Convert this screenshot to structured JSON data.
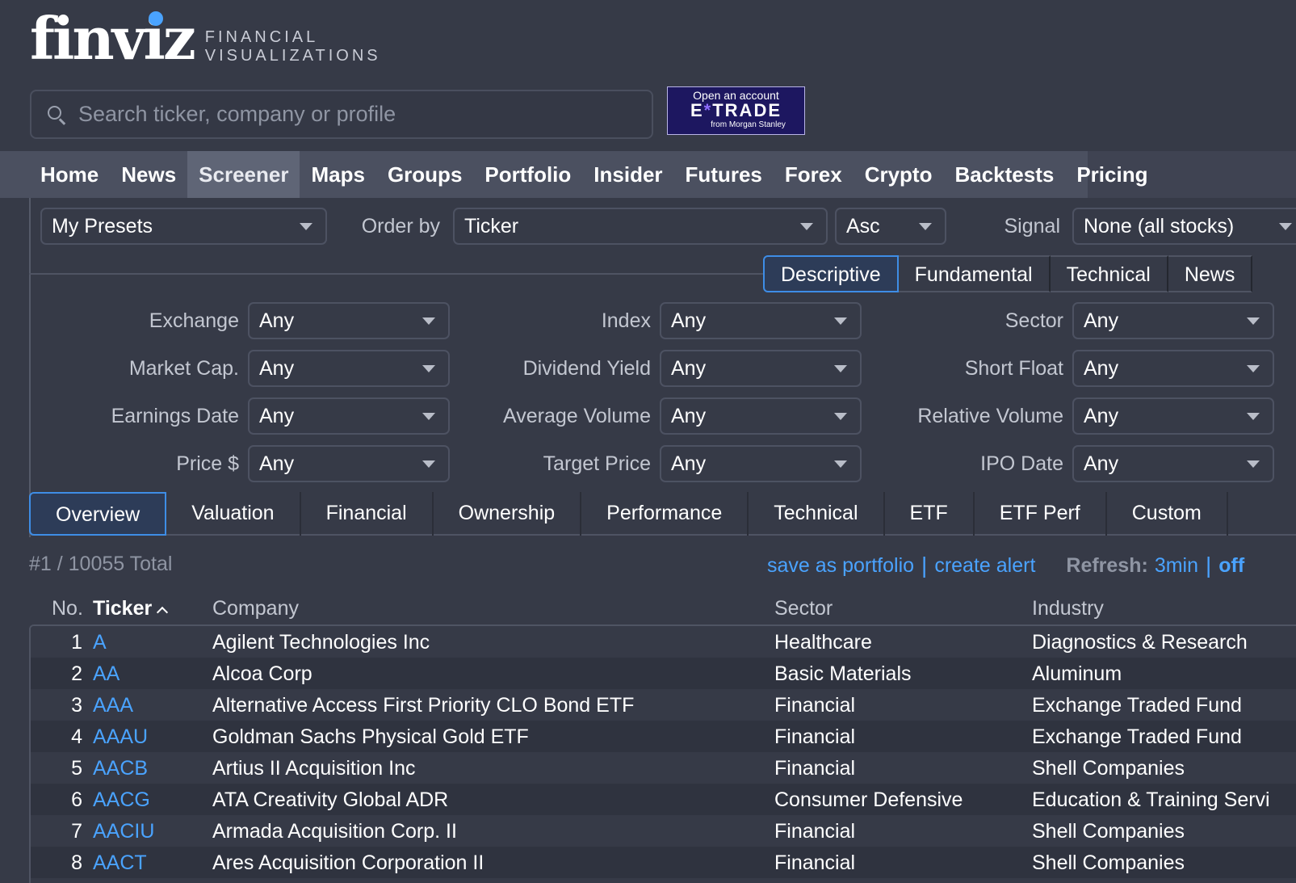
{
  "header": {
    "logo_word": "finviz",
    "logo_sub_line1": "FINANCIAL",
    "logo_sub_line2": "VISUALIZATIONS",
    "search_placeholder": "Search ticker, company or profile",
    "ad": {
      "top": "Open an account",
      "brand_a": "E",
      "brand_star": "*",
      "brand_b": "TRADE",
      "sub": "from Morgan Stanley"
    }
  },
  "nav": {
    "items": [
      "Home",
      "News",
      "Screener",
      "Maps",
      "Groups",
      "Portfolio",
      "Insider",
      "Futures",
      "Forex",
      "Crypto",
      "Backtests",
      "Pricing"
    ],
    "active": "Screener"
  },
  "controls": {
    "presets": "My Presets",
    "order_by_label": "Order by",
    "order_by": "Ticker",
    "direction": "Asc",
    "signal_label": "Signal",
    "signal": "None (all stocks)"
  },
  "filter_tabs": [
    "Descriptive",
    "Fundamental",
    "Technical",
    "News"
  ],
  "filters": [
    {
      "label": "Exchange",
      "value": "Any"
    },
    {
      "label": "Index",
      "value": "Any"
    },
    {
      "label": "Sector",
      "value": "Any"
    },
    {
      "label": "Market Cap.",
      "value": "Any"
    },
    {
      "label": "Dividend Yield",
      "value": "Any"
    },
    {
      "label": "Short Float",
      "value": "Any"
    },
    {
      "label": "Earnings Date",
      "value": "Any"
    },
    {
      "label": "Average Volume",
      "value": "Any"
    },
    {
      "label": "Relative Volume",
      "value": "Any"
    },
    {
      "label": "Price $",
      "value": "Any"
    },
    {
      "label": "Target Price",
      "value": "Any"
    },
    {
      "label": "IPO Date",
      "value": "Any"
    }
  ],
  "view_tabs": [
    "Overview",
    "Valuation",
    "Financial",
    "Ownership",
    "Performance",
    "Technical",
    "ETF",
    "ETF Perf",
    "Custom"
  ],
  "results": {
    "total": "#1 / 10055 Total",
    "save_portfolio": "save as portfolio",
    "separator": "|",
    "create_alert": "create alert",
    "refresh_label": "Refresh:",
    "refresh_value": "3min",
    "refresh_off": "off"
  },
  "table": {
    "headers": {
      "no": "No.",
      "ticker": "Ticker",
      "company": "Company",
      "sector": "Sector",
      "industry": "Industry"
    },
    "rows": [
      {
        "no": "1",
        "ticker": "A",
        "company": "Agilent Technologies Inc",
        "sector": "Healthcare",
        "industry": "Diagnostics & Research"
      },
      {
        "no": "2",
        "ticker": "AA",
        "company": "Alcoa Corp",
        "sector": "Basic Materials",
        "industry": "Aluminum"
      },
      {
        "no": "3",
        "ticker": "AAA",
        "company": "Alternative Access First Priority CLO Bond ETF",
        "sector": "Financial",
        "industry": "Exchange Traded Fund"
      },
      {
        "no": "4",
        "ticker": "AAAU",
        "company": "Goldman Sachs Physical Gold ETF",
        "sector": "Financial",
        "industry": "Exchange Traded Fund"
      },
      {
        "no": "5",
        "ticker": "AACB",
        "company": "Artius II Acquisition Inc",
        "sector": "Financial",
        "industry": "Shell Companies"
      },
      {
        "no": "6",
        "ticker": "AACG",
        "company": "ATA Creativity Global ADR",
        "sector": "Consumer Defensive",
        "industry": "Education & Training Servi"
      },
      {
        "no": "7",
        "ticker": "AACIU",
        "company": "Armada Acquisition Corp. II",
        "sector": "Financial",
        "industry": "Shell Companies"
      },
      {
        "no": "8",
        "ticker": "AACT",
        "company": "Ares Acquisition Corporation II",
        "sector": "Financial",
        "industry": "Shell Companies"
      }
    ]
  }
}
